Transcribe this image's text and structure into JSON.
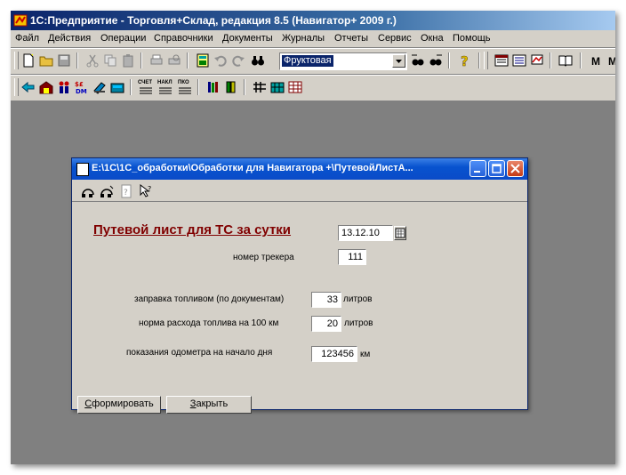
{
  "app": {
    "title": "1С:Предприятие - Торговля+Склад, редакция 8.5 (Навигатор+ 2009 г.)"
  },
  "menu": {
    "items": [
      "Файл",
      "Действия",
      "Операции",
      "Справочники",
      "Документы",
      "Журналы",
      "Отчеты",
      "Сервис",
      "Окна",
      "Помощь"
    ]
  },
  "toolbar": {
    "combo_value": "Фруктовая",
    "right_labels": [
      "М",
      "М"
    ]
  },
  "toolbar2": {
    "labels": [
      "СЧЕТ",
      "НАКЛ",
      "ПКО"
    ]
  },
  "dialog": {
    "title": "E:\\1С\\1С_обработки\\Обработки для Навигатора +\\ПутевойЛистА...",
    "heading": "Путевой лист для ТС за сутки",
    "date_value": "13.12.10",
    "tracker_label": "номер трекера",
    "tracker_value": "111",
    "fuel_label": "заправка топливом (по документам)",
    "fuel_value": "33",
    "fuel_unit": "литров",
    "norm_label": "норма расхода топлива на 100 км",
    "norm_value": "20",
    "norm_unit": "литров",
    "odometer_label": "показания одометра на начало дня",
    "odometer_value": "123456",
    "odometer_unit": "км",
    "form_button_rest": "формировать",
    "form_button_key": "С",
    "close_button_rest": "акрыть",
    "close_button_key": "З"
  }
}
